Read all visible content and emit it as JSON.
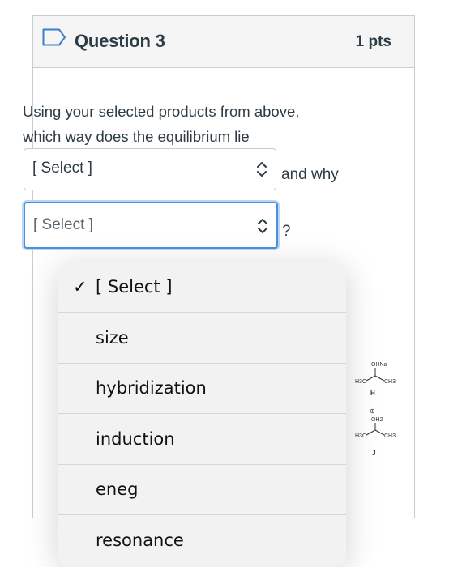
{
  "question": {
    "title": "Question 3",
    "points": "1 pts",
    "prompt_line1": "Using your selected products from above,",
    "prompt_line2": "which way does the equilibrium lie"
  },
  "select_direction": {
    "value": "[ Select ]"
  },
  "select_reason": {
    "value": "[ Select ]"
  },
  "text_after_first_select": "and why",
  "text_after_second_select": "?",
  "molecules": {
    "H": {
      "label": "H",
      "top_group": "OHNa",
      "left_group": "H3C",
      "right_group": "CH3"
    },
    "J": {
      "label": "J",
      "charge": "⊕",
      "top_group": "OH2",
      "left_group": "H3C",
      "right_group": "CH3"
    }
  },
  "dropdown": {
    "selected_index": 0,
    "check_glyph": "✓",
    "options": [
      "[ Select ]",
      "size",
      "hybridization",
      "induction",
      "eneg",
      "resonance"
    ]
  }
}
